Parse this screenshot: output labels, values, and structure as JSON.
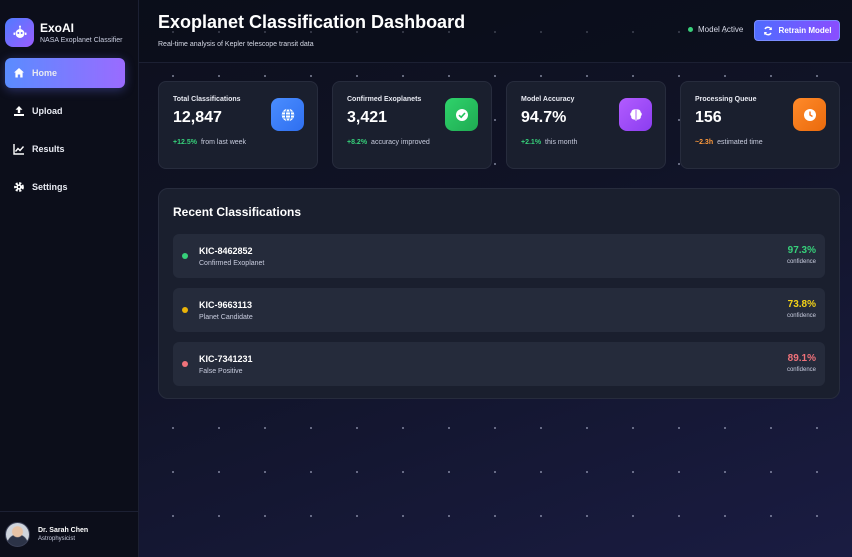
{
  "brand": {
    "name": "ExoAI",
    "subtitle": "NASA Exoplanet Classifier"
  },
  "nav": [
    {
      "label": "Home",
      "icon": "home-icon",
      "active": true
    },
    {
      "label": "Upload",
      "icon": "upload-icon",
      "active": false
    },
    {
      "label": "Results",
      "icon": "chart-line-icon",
      "active": false
    },
    {
      "label": "Settings",
      "icon": "gear-icon",
      "active": false
    }
  ],
  "user": {
    "name": "Dr. Sarah Chen",
    "role": "Astrophysicist"
  },
  "header": {
    "title": "Exoplanet Classification Dashboard",
    "subtitle": "Real-time analysis of Kepler telescope transit data",
    "status": "Model Active",
    "retrain_label": "Retrain Model"
  },
  "cards": [
    {
      "label": "Total Classifications",
      "value": "12,847",
      "delta": "+12.5%",
      "note": "from last week",
      "icon": "globe-icon",
      "icon_color": "#3b82f6"
    },
    {
      "label": "Confirmed Exoplanets",
      "value": "3,421",
      "delta": "+8.2%",
      "note": "accuracy improved",
      "icon": "check-circle-icon",
      "icon_color": "#22c55e"
    },
    {
      "label": "Model Accuracy",
      "value": "94.7%",
      "delta": "+2.1%",
      "note": "this month",
      "icon": "brain-icon",
      "icon_color": "#a855f7"
    },
    {
      "label": "Processing Queue",
      "value": "156",
      "delta": "~2.3h",
      "note": "estimated time",
      "icon": "clock-icon",
      "icon_color": "#f97316"
    }
  ],
  "recent": {
    "title": "Recent Classifications",
    "confidence_label": "confidence",
    "items": [
      {
        "id": "KIC-8462852",
        "status": "Confirmed Exoplanet",
        "confidence": "97.3%",
        "color": "#36d07a"
      },
      {
        "id": "KIC-9663113",
        "status": "Planet Candidate",
        "confidence": "73.8%",
        "color": "#eab308"
      },
      {
        "id": "KIC-7341231",
        "status": "False Positive",
        "confidence": "89.1%",
        "color": "#f0727a"
      }
    ]
  },
  "colors": {
    "accent": "#5a8cff",
    "accent2": "#9a6bff",
    "panel": "#1a1f2e"
  }
}
